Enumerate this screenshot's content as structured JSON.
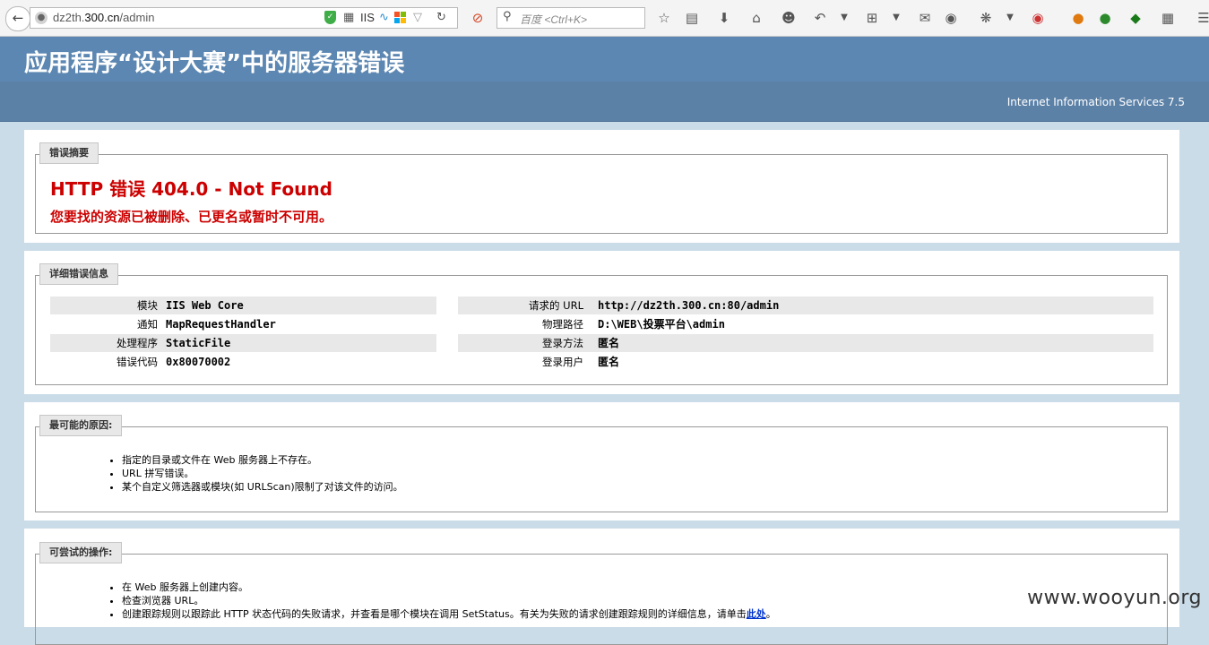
{
  "browser": {
    "url_prefix": "dz2th.",
    "url_domain": "300.cn",
    "url_path": "/admin",
    "url_badge_iis": "IIS",
    "search_placeholder": "百度 <Ctrl+K>"
  },
  "page": {
    "title": "应用程序“设计大赛”中的服务器错误",
    "server": "Internet Information Services 7.5"
  },
  "summary": {
    "legend": "错误摘要",
    "error_title": "HTTP 错误 404.0 - Not Found",
    "error_message": "您要找的资源已被删除、已更名或暂时不可用。"
  },
  "details": {
    "legend": "详细错误信息",
    "left": [
      {
        "label": "模块",
        "value": "IIS Web Core"
      },
      {
        "label": "通知",
        "value": "MapRequestHandler"
      },
      {
        "label": "处理程序",
        "value": "StaticFile"
      },
      {
        "label": "错误代码",
        "value": "0x80070002"
      }
    ],
    "right": [
      {
        "label": "请求的 URL",
        "value": "http://dz2th.300.cn:80/admin"
      },
      {
        "label": "物理路径",
        "value": "D:\\WEB\\投票平台\\admin"
      },
      {
        "label": "登录方法",
        "value": "匿名"
      },
      {
        "label": "登录用户",
        "value": "匿名"
      }
    ]
  },
  "causes": {
    "legend": "最可能的原因:",
    "items": [
      "指定的目录或文件在 Web 服务器上不存在。",
      "URL 拼写错误。",
      "某个自定义筛选器或模块(如 URLScan)限制了对该文件的访问。"
    ]
  },
  "actions": {
    "legend": "可尝试的操作:",
    "items": [
      "在 Web 服务器上创建内容。",
      "检查浏览器 URL。"
    ],
    "trace_text": "创建跟踪规则以跟踪此 HTTP 状态代码的失败请求，并查看是哪个模块在调用 SetStatus。有关为失败的请求创建跟踪规则的详细信息，请单击",
    "trace_link": "此处",
    "trace_end": "。"
  },
  "watermark": "www.wooyun.org",
  "colors": {
    "header": "#5c87b2",
    "subheader": "#5c81a7",
    "background": "#cadce8",
    "error_red": "#cc0000"
  }
}
